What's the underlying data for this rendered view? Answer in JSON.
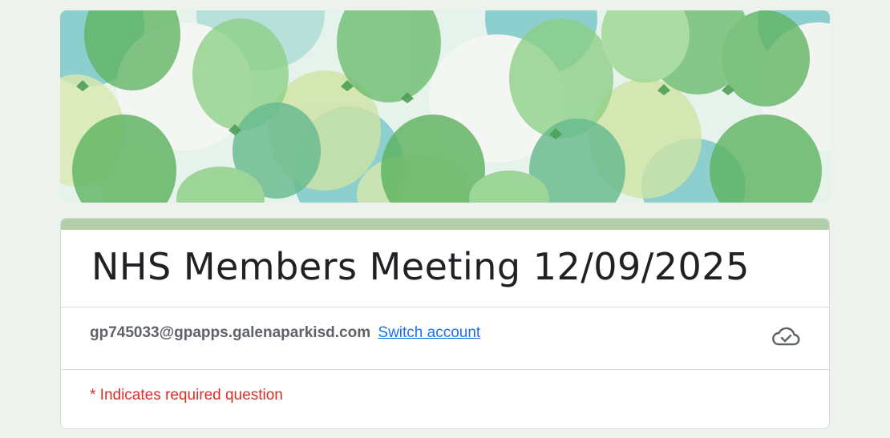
{
  "form": {
    "title": "NHS Members Meeting 12/09/2025",
    "accent_color": "#b2cfa8",
    "banner_theme": "green-balloons"
  },
  "account": {
    "email": "gp745033@gpapps.galenaparkisd.com",
    "switch_label": "Switch account",
    "status_icon": "cloud-saved-icon"
  },
  "required_note": "* Indicates required question"
}
